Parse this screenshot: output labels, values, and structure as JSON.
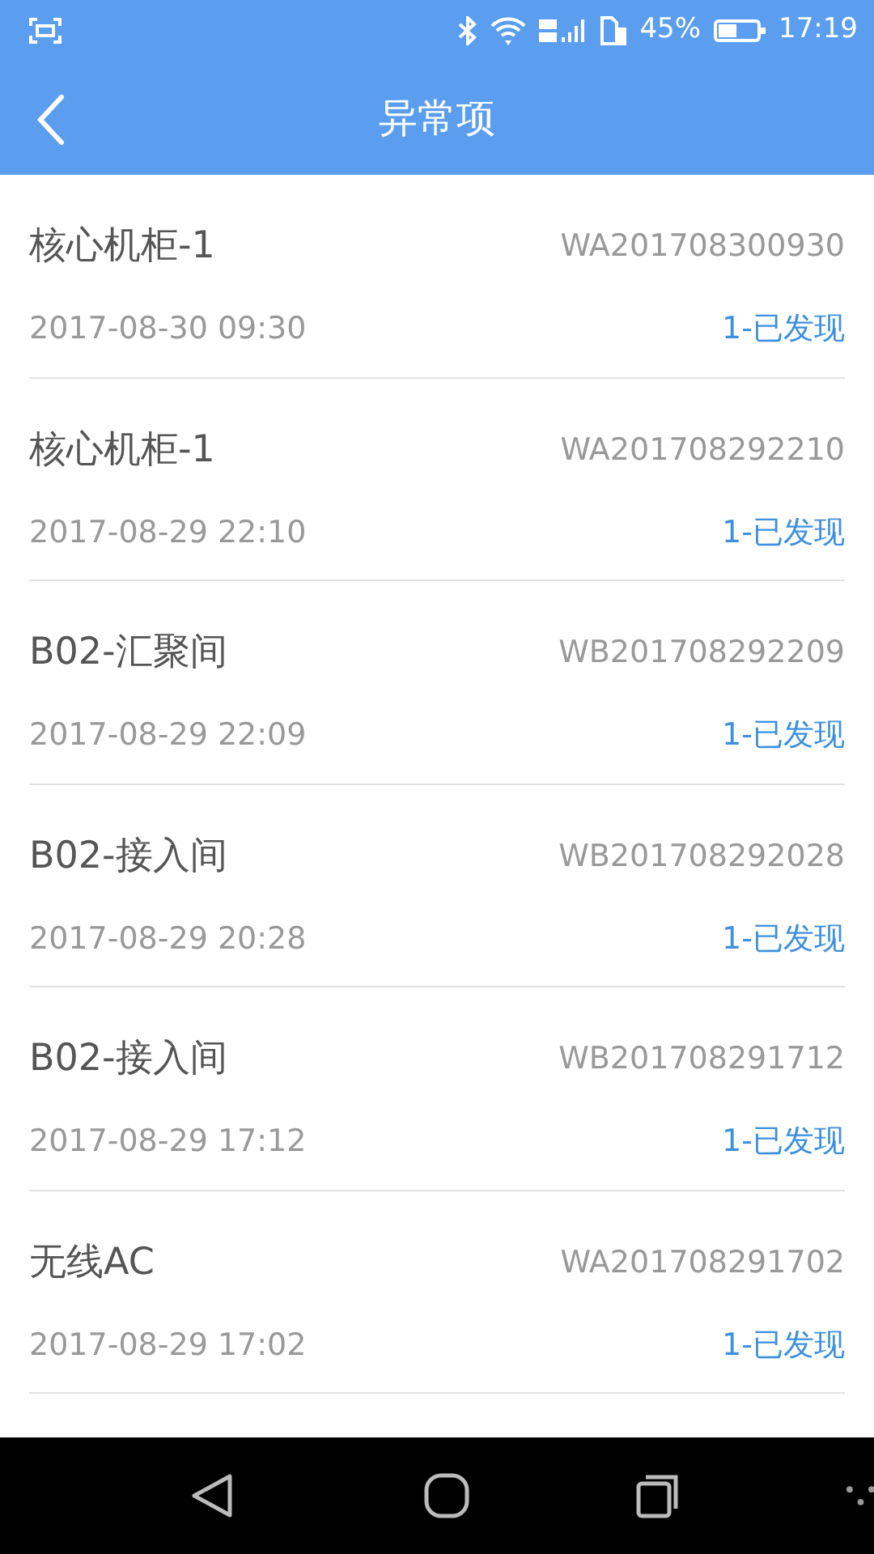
{
  "status_bar": {
    "battery": "45%",
    "time": "17:19"
  },
  "header": {
    "title": "异常项"
  },
  "records": [
    {
      "name": "核心机柜-1",
      "code": "WA201708300930",
      "time": "2017-08-30 09:30",
      "status": "1-已发现"
    },
    {
      "name": "核心机柜-1",
      "code": "WA201708292210",
      "time": "2017-08-29 22:10",
      "status": "1-已发现"
    },
    {
      "name": "B02-汇聚间",
      "code": "WB201708292209",
      "time": "2017-08-29 22:09",
      "status": "1-已发现"
    },
    {
      "name": "B02-接入间",
      "code": "WB201708292028",
      "time": "2017-08-29 20:28",
      "status": "1-已发现"
    },
    {
      "name": "B02-接入间",
      "code": "WB201708291712",
      "time": "2017-08-29 17:12",
      "status": "1-已发现"
    },
    {
      "name": "无线AC",
      "code": "WA201708291702",
      "time": "2017-08-29 17:02",
      "status": "1-已发现"
    }
  ]
}
